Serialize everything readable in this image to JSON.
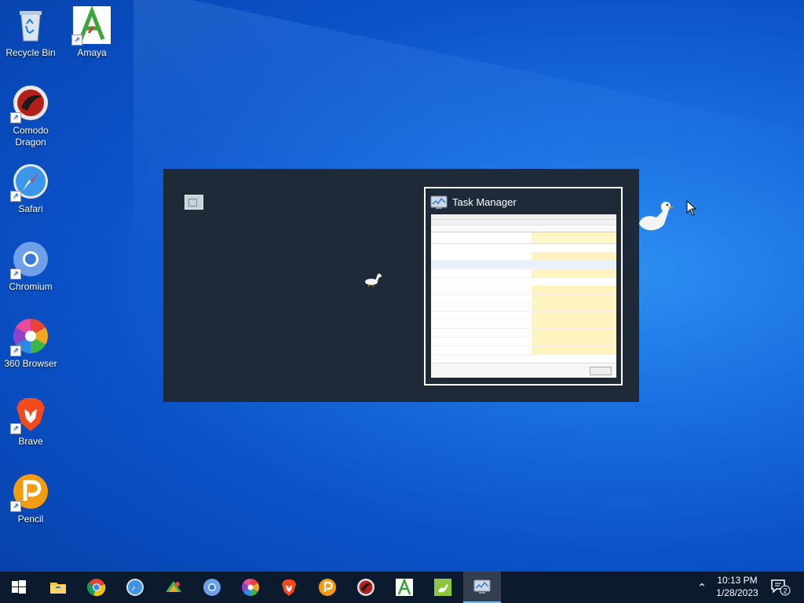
{
  "desktop": {
    "icons": [
      {
        "label": "Recycle Bin",
        "icon": "recycle-bin-icon"
      },
      {
        "label": "Amaya",
        "icon": "amaya-icon"
      },
      {
        "label": "Comodo Dragon",
        "icon": "comodo-dragon-icon"
      },
      {
        "label": "Safari",
        "icon": "safari-icon"
      },
      {
        "label": "Chromium",
        "icon": "chromium-icon"
      },
      {
        "label": "360 Browser",
        "icon": "360-browser-icon"
      },
      {
        "label": "Brave",
        "icon": "brave-icon"
      },
      {
        "label": "Pencil",
        "icon": "pencil-icon"
      }
    ]
  },
  "alt_tab": {
    "window_title": "Task Manager"
  },
  "taskbar": {
    "items": [
      {
        "name": "start-button",
        "icon": "windows-logo-icon"
      },
      {
        "name": "file-explorer",
        "icon": "folder-icon"
      },
      {
        "name": "chrome",
        "icon": "chrome-icon"
      },
      {
        "name": "safari",
        "icon": "safari-icon"
      },
      {
        "name": "app",
        "icon": "app-icon"
      },
      {
        "name": "chromium",
        "icon": "chromium-icon"
      },
      {
        "name": "360-browser",
        "icon": "360-browser-icon"
      },
      {
        "name": "brave",
        "icon": "brave-icon"
      },
      {
        "name": "pencil",
        "icon": "pencil-icon"
      },
      {
        "name": "comodo-dragon",
        "icon": "comodo-dragon-icon"
      },
      {
        "name": "amaya",
        "icon": "amaya-icon"
      },
      {
        "name": "goose",
        "icon": "goose-app-icon"
      },
      {
        "name": "task-manager",
        "icon": "task-manager-icon"
      }
    ],
    "clock": {
      "time": "10:13 PM",
      "date": "1/28/2023"
    },
    "notification_count": "2"
  },
  "colors": {
    "wallpaper": "#0b52c9",
    "taskbar": "#0c1a2d",
    "switcher": "#1f2a38"
  }
}
